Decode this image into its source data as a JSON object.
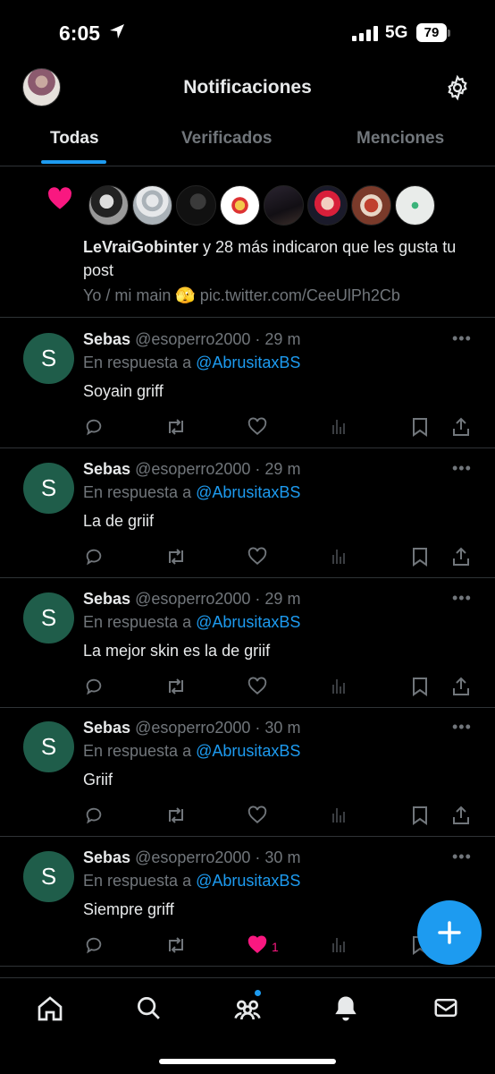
{
  "status_bar": {
    "time": "6:05",
    "network": "5G",
    "battery": "79"
  },
  "header": {
    "title": "Notificaciones"
  },
  "tabs": [
    {
      "label": "Todas",
      "active": true
    },
    {
      "label": "Verificados",
      "active": false
    },
    {
      "label": "Menciones",
      "active": false
    }
  ],
  "like_notification": {
    "user": "LeVraiGobinter",
    "text": " y 28 más indicaron que les gusta tu post",
    "preview": "Yo / mi main 🫣 pic.twitter.com/CeeUlPh2Cb"
  },
  "tweets": [
    {
      "name": "Sebas",
      "handle": "@esoperro2000 · 29 m",
      "reply_prefix": "En respuesta a ",
      "reply_to": "@AbrusitaxBS",
      "body": "Soyain griff",
      "liked": false,
      "like_count": ""
    },
    {
      "name": "Sebas",
      "handle": "@esoperro2000 · 29 m",
      "reply_prefix": "En respuesta a ",
      "reply_to": "@AbrusitaxBS",
      "body": "La de griif",
      "liked": false,
      "like_count": ""
    },
    {
      "name": "Sebas",
      "handle": "@esoperro2000 · 29 m",
      "reply_prefix": "En respuesta a ",
      "reply_to": "@AbrusitaxBS",
      "body": "La mejor skin es la de griif",
      "liked": false,
      "like_count": ""
    },
    {
      "name": "Sebas",
      "handle": "@esoperro2000 · 30 m",
      "reply_prefix": "En respuesta a ",
      "reply_to": "@AbrusitaxBS",
      "body": "Griif",
      "liked": false,
      "like_count": ""
    },
    {
      "name": "Sebas",
      "handle": "@esoperro2000 · 30 m",
      "reply_prefix": "En respuesta a ",
      "reply_to": "@AbrusitaxBS",
      "body": "Siempre griff",
      "liked": true,
      "like_count": "1"
    }
  ],
  "avatar_letter": "S",
  "colors": {
    "accent": "#1d9bf0",
    "like": "#f91880",
    "muted": "#71767b",
    "avatar_bg": "#1f5d4a"
  },
  "icons": [
    "home-icon",
    "search-icon",
    "communities-icon",
    "bell-icon",
    "mail-icon",
    "gear-icon",
    "compose-icon"
  ]
}
